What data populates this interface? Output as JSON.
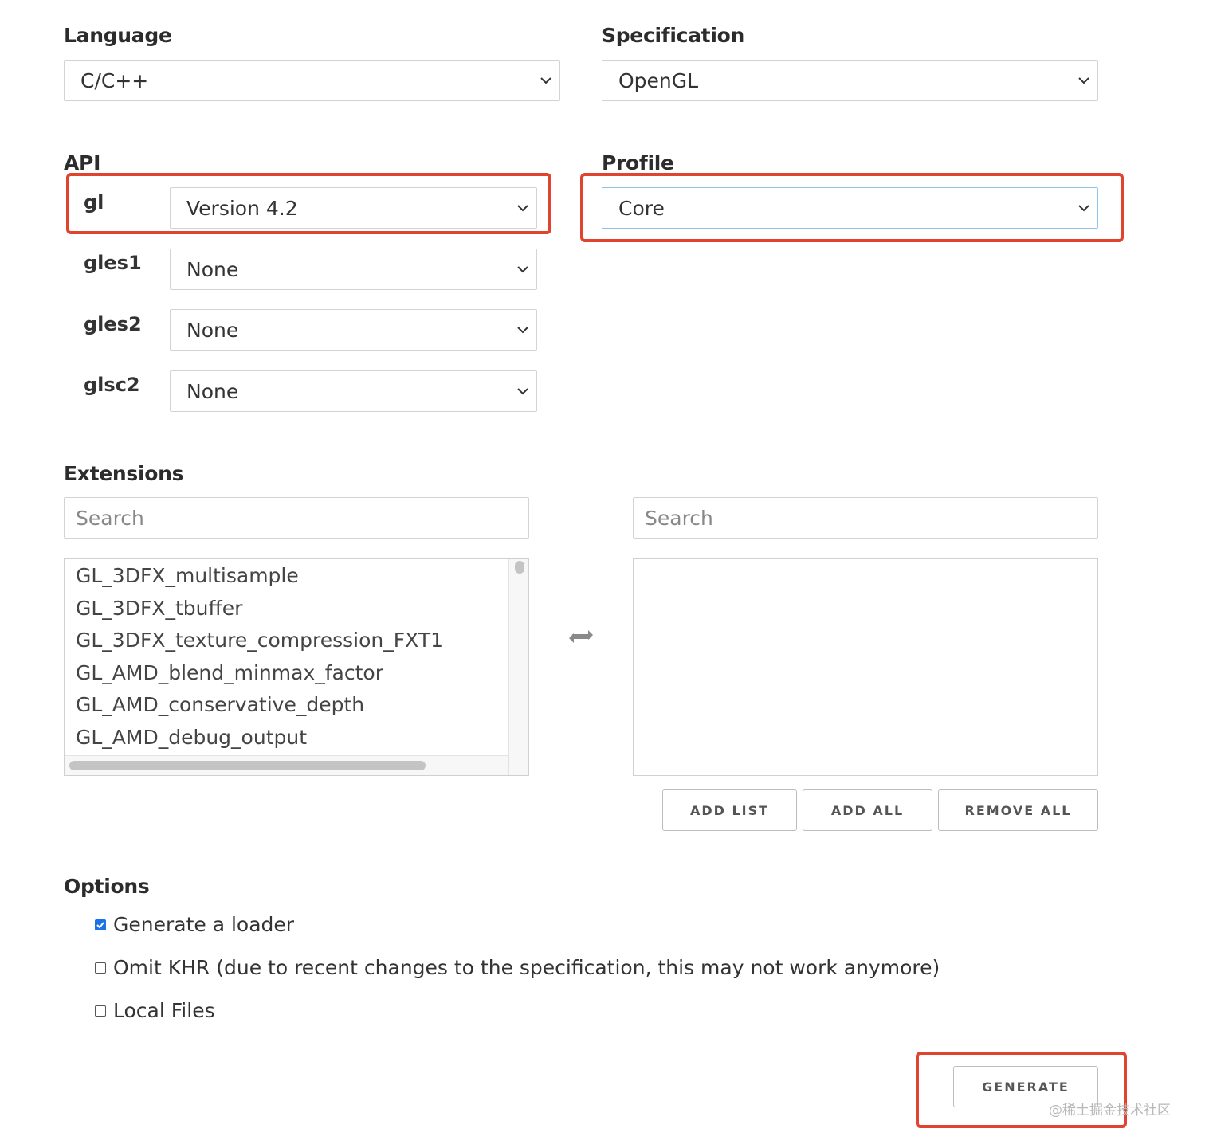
{
  "language": {
    "label": "Language",
    "value": "C/C++"
  },
  "specification": {
    "label": "Specification",
    "value": "OpenGL"
  },
  "api": {
    "label": "API",
    "rows": [
      {
        "name": "gl",
        "value": "Version 4.2"
      },
      {
        "name": "gles1",
        "value": "None"
      },
      {
        "name": "gles2",
        "value": "None"
      },
      {
        "name": "glsc2",
        "value": "None"
      }
    ]
  },
  "profile": {
    "label": "Profile",
    "value": "Core"
  },
  "extensions": {
    "label": "Extensions",
    "search_left_placeholder": "Search",
    "search_right_placeholder": "Search",
    "available": [
      "GL_3DFX_multisample",
      "GL_3DFX_tbuffer",
      "GL_3DFX_texture_compression_FXT1",
      "GL_AMD_blend_minmax_factor",
      "GL_AMD_conservative_depth",
      "GL_AMD_debug_output"
    ],
    "swap_icon": "swap-arrows-icon",
    "buttons": {
      "add_list": "ADD LIST",
      "add_all": "ADD ALL",
      "remove_all": "REMOVE ALL"
    }
  },
  "options": {
    "label": "Options",
    "items": [
      {
        "label": "Generate a loader",
        "checked": true
      },
      {
        "label": "Omit KHR (due to recent changes to the specification, this may not work anymore)",
        "checked": false
      },
      {
        "label": "Local Files",
        "checked": false
      }
    ]
  },
  "generate_label": "GENERATE",
  "watermark": "@稀土掘金技术社区",
  "colors": {
    "highlight": "#e0432e",
    "checkbox": "#1a73e8",
    "focus_border": "#8fc6e8"
  }
}
